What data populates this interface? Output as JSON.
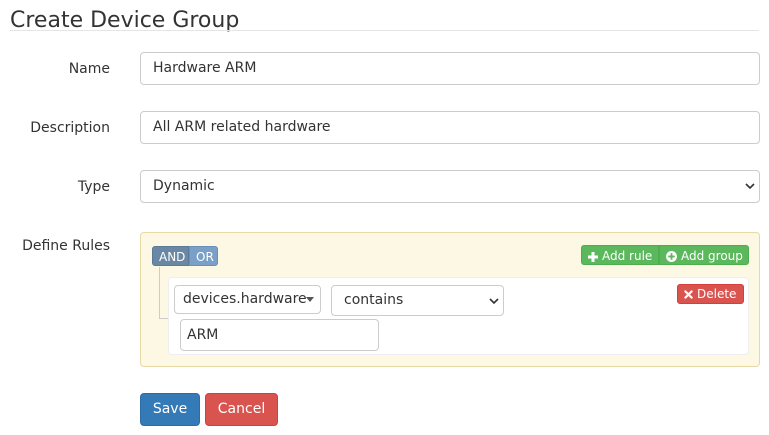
{
  "page": {
    "title": "Create Device Group"
  },
  "form": {
    "name": {
      "label": "Name",
      "value": "Hardware ARM"
    },
    "description": {
      "label": "Description",
      "value": "All ARM related hardware"
    },
    "type": {
      "label": "Type",
      "value": "Dynamic"
    },
    "rules": {
      "label": "Define Rules",
      "and_label": "AND",
      "or_label": "OR",
      "add_rule_label": "Add rule",
      "add_group_label": "Add group",
      "rule": {
        "field": "devices.hardware",
        "operator": "contains",
        "value": "ARM",
        "delete_label": "Delete"
      }
    }
  },
  "actions": {
    "save_label": "Save",
    "cancel_label": "Cancel"
  },
  "colors": {
    "primary": "#337ab7",
    "danger": "#d9534f",
    "success": "#5cb85c",
    "rules_bg": "#fcf8e3"
  }
}
